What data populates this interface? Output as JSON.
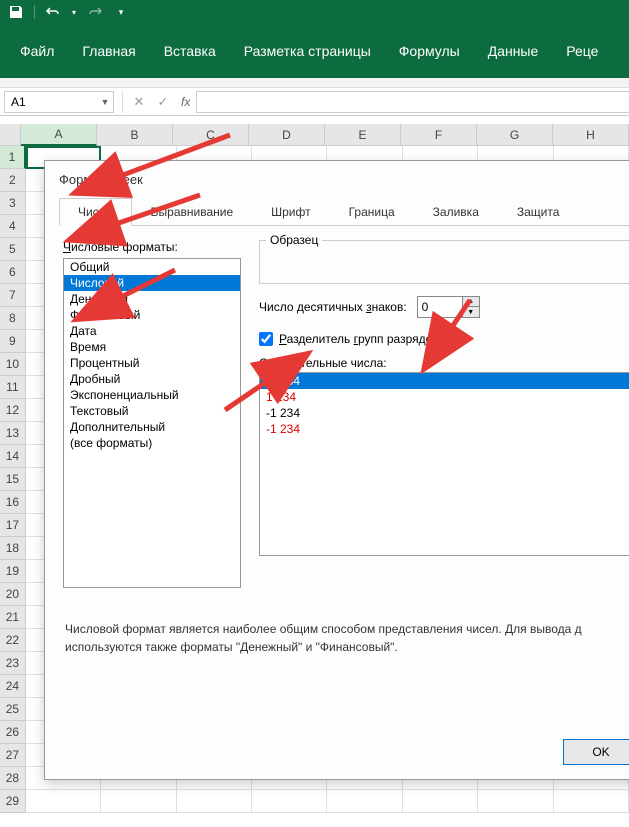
{
  "ribbon": {
    "tabs": [
      "Файл",
      "Главная",
      "Вставка",
      "Разметка страницы",
      "Формулы",
      "Данные",
      "Реце"
    ]
  },
  "namebox": {
    "value": "A1"
  },
  "columns": [
    "A",
    "B",
    "C",
    "D",
    "E",
    "F",
    "G",
    "H"
  ],
  "rows": [
    1,
    2,
    3,
    4,
    5,
    6,
    7,
    8,
    9,
    10,
    11,
    12,
    13,
    14,
    15,
    16,
    17,
    18,
    19,
    20,
    21,
    22,
    23,
    24,
    25,
    26,
    27,
    28,
    29
  ],
  "dialog": {
    "title": "Формат ячеек",
    "tabs": [
      "Число",
      "Выравнивание",
      "Шрифт",
      "Граница",
      "Заливка",
      "Защита"
    ],
    "active_tab": 0,
    "category_label": "Числовые форматы:",
    "categories": [
      "Общий",
      "Числовой",
      "Денежный",
      "Финансовый",
      "Дата",
      "Время",
      "Процентный",
      "Дробный",
      "Экспоненциальный",
      "Текстовый",
      "Дополнительный",
      "(все форматы)"
    ],
    "selected_category": 1,
    "sample_label": "Образец",
    "decimal_label": "Число десятичных знаков:",
    "decimal_value": "0",
    "separator_checked": true,
    "separator_label": "Разделитель групп разрядов ( )",
    "negative_label": "Отрицательные числа:",
    "negative_items": [
      {
        "text": "-1 234",
        "red": false,
        "sel": true
      },
      {
        "text": "1 234",
        "red": true,
        "sel": false
      },
      {
        "text": "-1 234",
        "red": false,
        "sel": false
      },
      {
        "text": "-1 234",
        "red": true,
        "sel": false
      }
    ],
    "description": "Числовой формат является наиболее общим способом представления чисел. Для вывода д используются также форматы \"Денежный\" и \"Финансовый\".",
    "ok": "OK"
  }
}
